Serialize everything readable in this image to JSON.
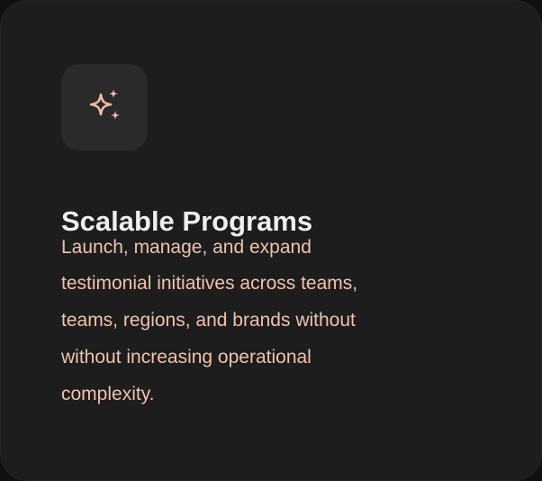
{
  "card": {
    "icon": "sparkles-icon",
    "title": "Scalable Programs",
    "description_lines": [
      "Launch, manage, and expand",
      "testimonial initiatives across teams,",
      "teams, regions, and brands without",
      "without increasing operational",
      "complexity."
    ]
  },
  "colors": {
    "background": "#1d1d1e",
    "icon_tile": "#2a2a2b",
    "accent": "#f4b9a4",
    "title": "#eeeeee",
    "body_text": "#f0c2ae"
  }
}
